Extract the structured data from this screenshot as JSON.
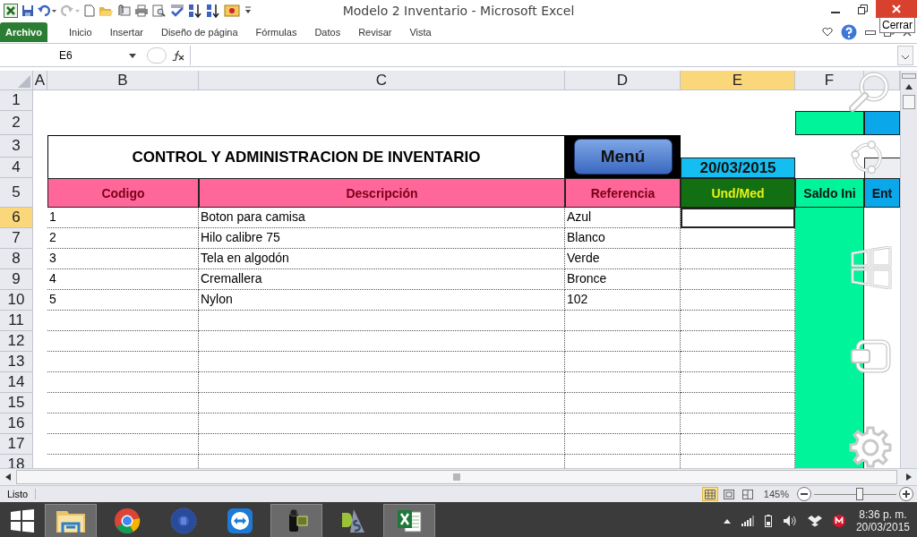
{
  "window": {
    "title": "Modelo 2 Inventario  -  Microsoft Excel",
    "tooltip": "Cerrar"
  },
  "ribbon_tabs": [
    {
      "label": "Archivo",
      "kind": "file"
    },
    {
      "label": "Inicio",
      "kind": "tab"
    },
    {
      "label": "Insertar",
      "kind": "tab"
    },
    {
      "label": "Diseño de página",
      "kind": "tab"
    },
    {
      "label": "Fórmulas",
      "kind": "tab"
    },
    {
      "label": "Datos",
      "kind": "tab"
    },
    {
      "label": "Revisar",
      "kind": "tab"
    },
    {
      "label": "Vista",
      "kind": "tab"
    }
  ],
  "name_box": "E6",
  "columns": [
    {
      "label": "A",
      "selected": false
    },
    {
      "label": "B",
      "selected": false
    },
    {
      "label": "C",
      "selected": false
    },
    {
      "label": "D",
      "selected": false
    },
    {
      "label": "E",
      "selected": true
    },
    {
      "label": "F",
      "selected": false
    }
  ],
  "rows": [
    {
      "label": "1",
      "selected": false
    },
    {
      "label": "2",
      "selected": false
    },
    {
      "label": "3",
      "selected": false
    },
    {
      "label": "4",
      "selected": false
    },
    {
      "label": "5",
      "selected": false
    },
    {
      "label": "6",
      "selected": true
    },
    {
      "label": "7",
      "selected": false
    },
    {
      "label": "8",
      "selected": false
    },
    {
      "label": "9",
      "selected": false
    },
    {
      "label": "10",
      "selected": false
    },
    {
      "label": "11",
      "selected": false
    },
    {
      "label": "12",
      "selected": false
    },
    {
      "label": "13",
      "selected": false
    },
    {
      "label": "14",
      "selected": false
    },
    {
      "label": "15",
      "selected": false
    },
    {
      "label": "16",
      "selected": false
    },
    {
      "label": "17",
      "selected": false
    },
    {
      "label": "18",
      "selected": false
    }
  ],
  "sheet": {
    "title": "CONTROL Y ADMINISTRACION DE INVENTARIO",
    "menu_button": "Menú",
    "date": "20/03/2015",
    "bands": [
      {
        "color": "#00f59a"
      },
      {
        "color": "#0aa7ea"
      }
    ],
    "headers": [
      {
        "label": "Codigo",
        "color": "#ff6699"
      },
      {
        "label": "Descripción",
        "color": "#ff6699"
      },
      {
        "label": "Referencia",
        "color": "#ff6699"
      },
      {
        "label": "Und/Med",
        "color": "#127012"
      },
      {
        "label": "Saldo Ini",
        "color": "#00f59a"
      },
      {
        "label": "Ent",
        "color": "#0aa7ea"
      }
    ],
    "items": [
      {
        "codigo": "1",
        "descripcion": "Boton para camisa",
        "referencia": "Azul"
      },
      {
        "codigo": "2",
        "descripcion": "Hilo calibre 75",
        "referencia": "Blanco"
      },
      {
        "codigo": "3",
        "descripcion": "Tela en algodón",
        "referencia": "Verde"
      },
      {
        "codigo": "4",
        "descripcion": "Cremallera",
        "referencia": "Bronce"
      },
      {
        "codigo": "5",
        "descripcion": "Nylon",
        "referencia": "102"
      }
    ]
  },
  "status_bar": {
    "status": "Listo",
    "zoom": "145%",
    "level": 0.55
  },
  "taskbar": {
    "apps": [
      {
        "kind": "folder",
        "open": true
      },
      {
        "kind": "browser",
        "open": false
      },
      {
        "kind": "disc",
        "open": false
      },
      {
        "kind": "remote",
        "open": false
      },
      {
        "kind": "camera",
        "open": true
      },
      {
        "kind": "ds",
        "open": false
      },
      {
        "kind": "excel",
        "open": true
      }
    ],
    "time": "8:36 p. m.",
    "date": "20/03/2015"
  }
}
